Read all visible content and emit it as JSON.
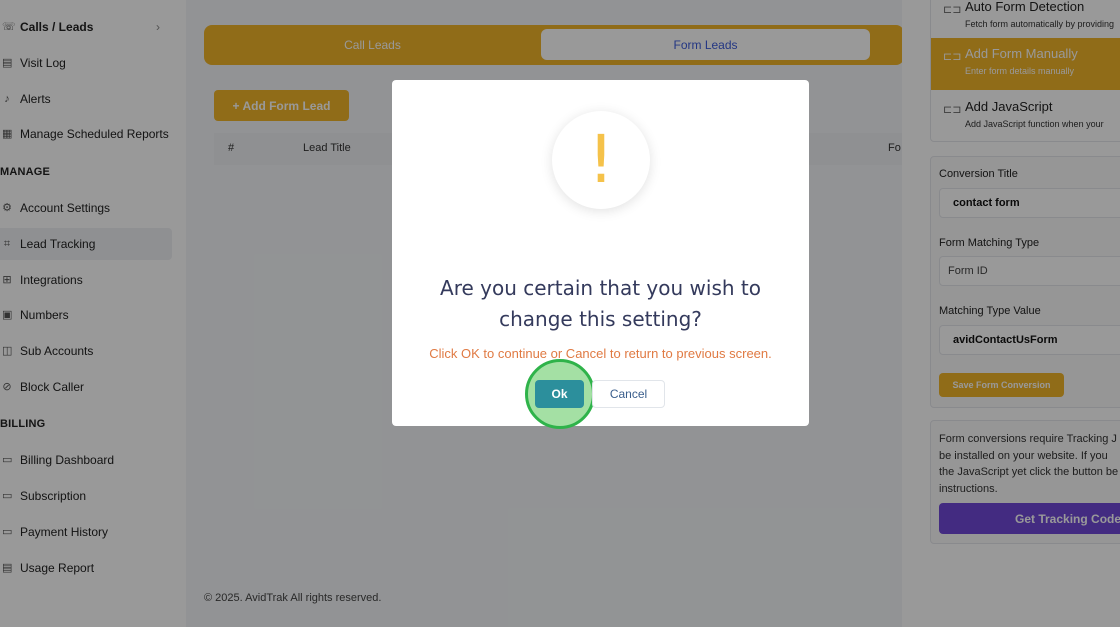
{
  "sidebar": {
    "calls_leads": "Calls / Leads",
    "items_top": [
      {
        "label": "Visit Log",
        "icon": "visit-log-icon"
      },
      {
        "label": "Alerts",
        "icon": "bell-icon"
      },
      {
        "label": "Manage Scheduled Reports",
        "icon": "calendar-icon"
      }
    ],
    "manage_heading": "MANAGE",
    "manage_items": [
      {
        "label": "Account Settings",
        "icon": "gear-icon"
      },
      {
        "label": "Lead Tracking",
        "icon": "lead-tracking-icon"
      },
      {
        "label": "Integrations",
        "icon": "integrations-icon"
      },
      {
        "label": "Numbers",
        "icon": "numbers-icon"
      },
      {
        "label": "Sub Accounts",
        "icon": "sub-accounts-icon"
      },
      {
        "label": "Block Caller",
        "icon": "block-icon"
      }
    ],
    "billing_heading": "BILLING",
    "billing_items": [
      {
        "label": "Billing Dashboard",
        "icon": "billing-icon"
      },
      {
        "label": "Subscription",
        "icon": "subscription-icon"
      },
      {
        "label": "Payment History",
        "icon": "payment-icon"
      },
      {
        "label": "Usage Report",
        "icon": "usage-icon"
      }
    ]
  },
  "main": {
    "tabs": [
      {
        "label": "Call Leads"
      },
      {
        "label": "Form Leads"
      }
    ],
    "add_button": "+ Add Form Lead",
    "table_headers": [
      "#",
      "Lead Title",
      "Fo"
    ],
    "footer": "© 2025. AvidTrak All rights reserved."
  },
  "right_panel": {
    "options": [
      {
        "title": "Auto Form Detection",
        "subtitle": "Fetch form automatically by providing",
        "selected": false
      },
      {
        "title": "Add Form Manually",
        "subtitle": "Enter form details manually",
        "selected": true
      },
      {
        "title": "Add JavaScript",
        "subtitle": "Add JavaScript function when your",
        "selected": false
      }
    ],
    "conversion_title_label": "Conversion Title",
    "conversion_title_value": "contact form",
    "matching_type_label": "Form Matching Type",
    "matching_type_value": "Form ID",
    "matching_value_label": "Matching Type Value",
    "matching_value_value": "avidContactUsForm",
    "save_button": "Save Form Conversion",
    "info_text": "Form conversions require Tracking J\nbe installed on your website. If you\nthe JavaScript yet click the button be\ninstructions.",
    "tracking_button": "Get Tracking Code"
  },
  "modal": {
    "icon": "!",
    "title_line1": "Are you certain that you wish to",
    "title_line2": "change this setting?",
    "subtitle": "Click OK to continue or Cancel to return to previous screen.",
    "ok_label": "Ok",
    "cancel_label": "Cancel"
  },
  "colors": {
    "accent": "#f0b429",
    "ok_button": "#2c8f9c",
    "tracking_button": "#7048d8",
    "warning_icon": "#f5c24a",
    "subtitle": "#e07a43",
    "highlight_ring": "#2fb34a"
  }
}
